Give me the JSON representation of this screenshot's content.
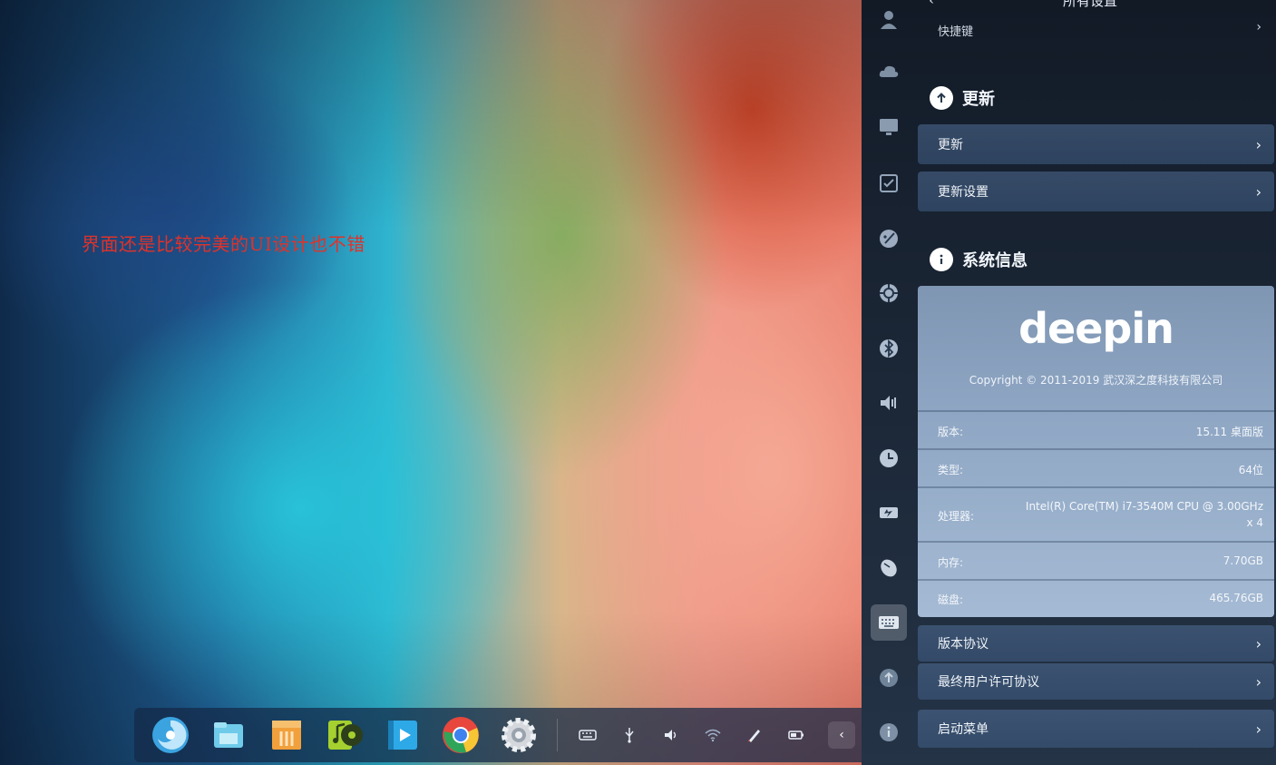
{
  "overlay_caption": "界面还是比较完美的UI设计也不错",
  "dock": {
    "apps": [
      {
        "name": "deepin-launcher-icon",
        "color": "#4fb6ea"
      },
      {
        "name": "file-manager-icon",
        "color": "#55bde6"
      },
      {
        "name": "app-store-icon",
        "color": "#f2a03c"
      },
      {
        "name": "music-icon",
        "color": "#9ccc2f"
      },
      {
        "name": "video-player-icon",
        "color": "#2ea9e8"
      },
      {
        "name": "chrome-icon",
        "color": "#e7473c"
      },
      {
        "name": "settings-gear-icon",
        "color": "#d9dde2"
      }
    ],
    "tray": [
      "keyboard-icon",
      "usb-icon",
      "volume-icon",
      "wifi-icon",
      "pen-icon",
      "battery-icon"
    ]
  },
  "panel": {
    "header_title": "所有设置",
    "prev_row_label": "快捷键",
    "update": {
      "section_title": "更新",
      "rows": [
        "更新",
        "更新设置"
      ]
    },
    "sysinfo": {
      "section_title": "系统信息",
      "logo": "deepin",
      "copyright": "Copyright © 2011-2019 武汉深之度科技有限公司",
      "rows": [
        {
          "key": "版本:",
          "value": "15.11 桌面版"
        },
        {
          "key": "类型:",
          "value": "64位"
        },
        {
          "key": "处理器:",
          "value": "Intel(R) Core(TM) i7-3540M CPU @ 3.00GHz",
          "value2": "x 4"
        },
        {
          "key": "内存:",
          "value": "7.70GB"
        },
        {
          "key": "磁盘:",
          "value": "465.76GB"
        }
      ]
    },
    "links": [
      "版本协议",
      "最终用户许可协议",
      "启动菜单"
    ]
  },
  "rail_icons": [
    "account-icon",
    "cloud-sync-icon",
    "display-icon",
    "default-apps-icon",
    "personalization-icon",
    "network-icon",
    "bluetooth-icon",
    "sound-icon",
    "time-icon",
    "power-icon",
    "mouse-icon",
    "keyboard-icon",
    "update-icon",
    "system-info-icon"
  ]
}
